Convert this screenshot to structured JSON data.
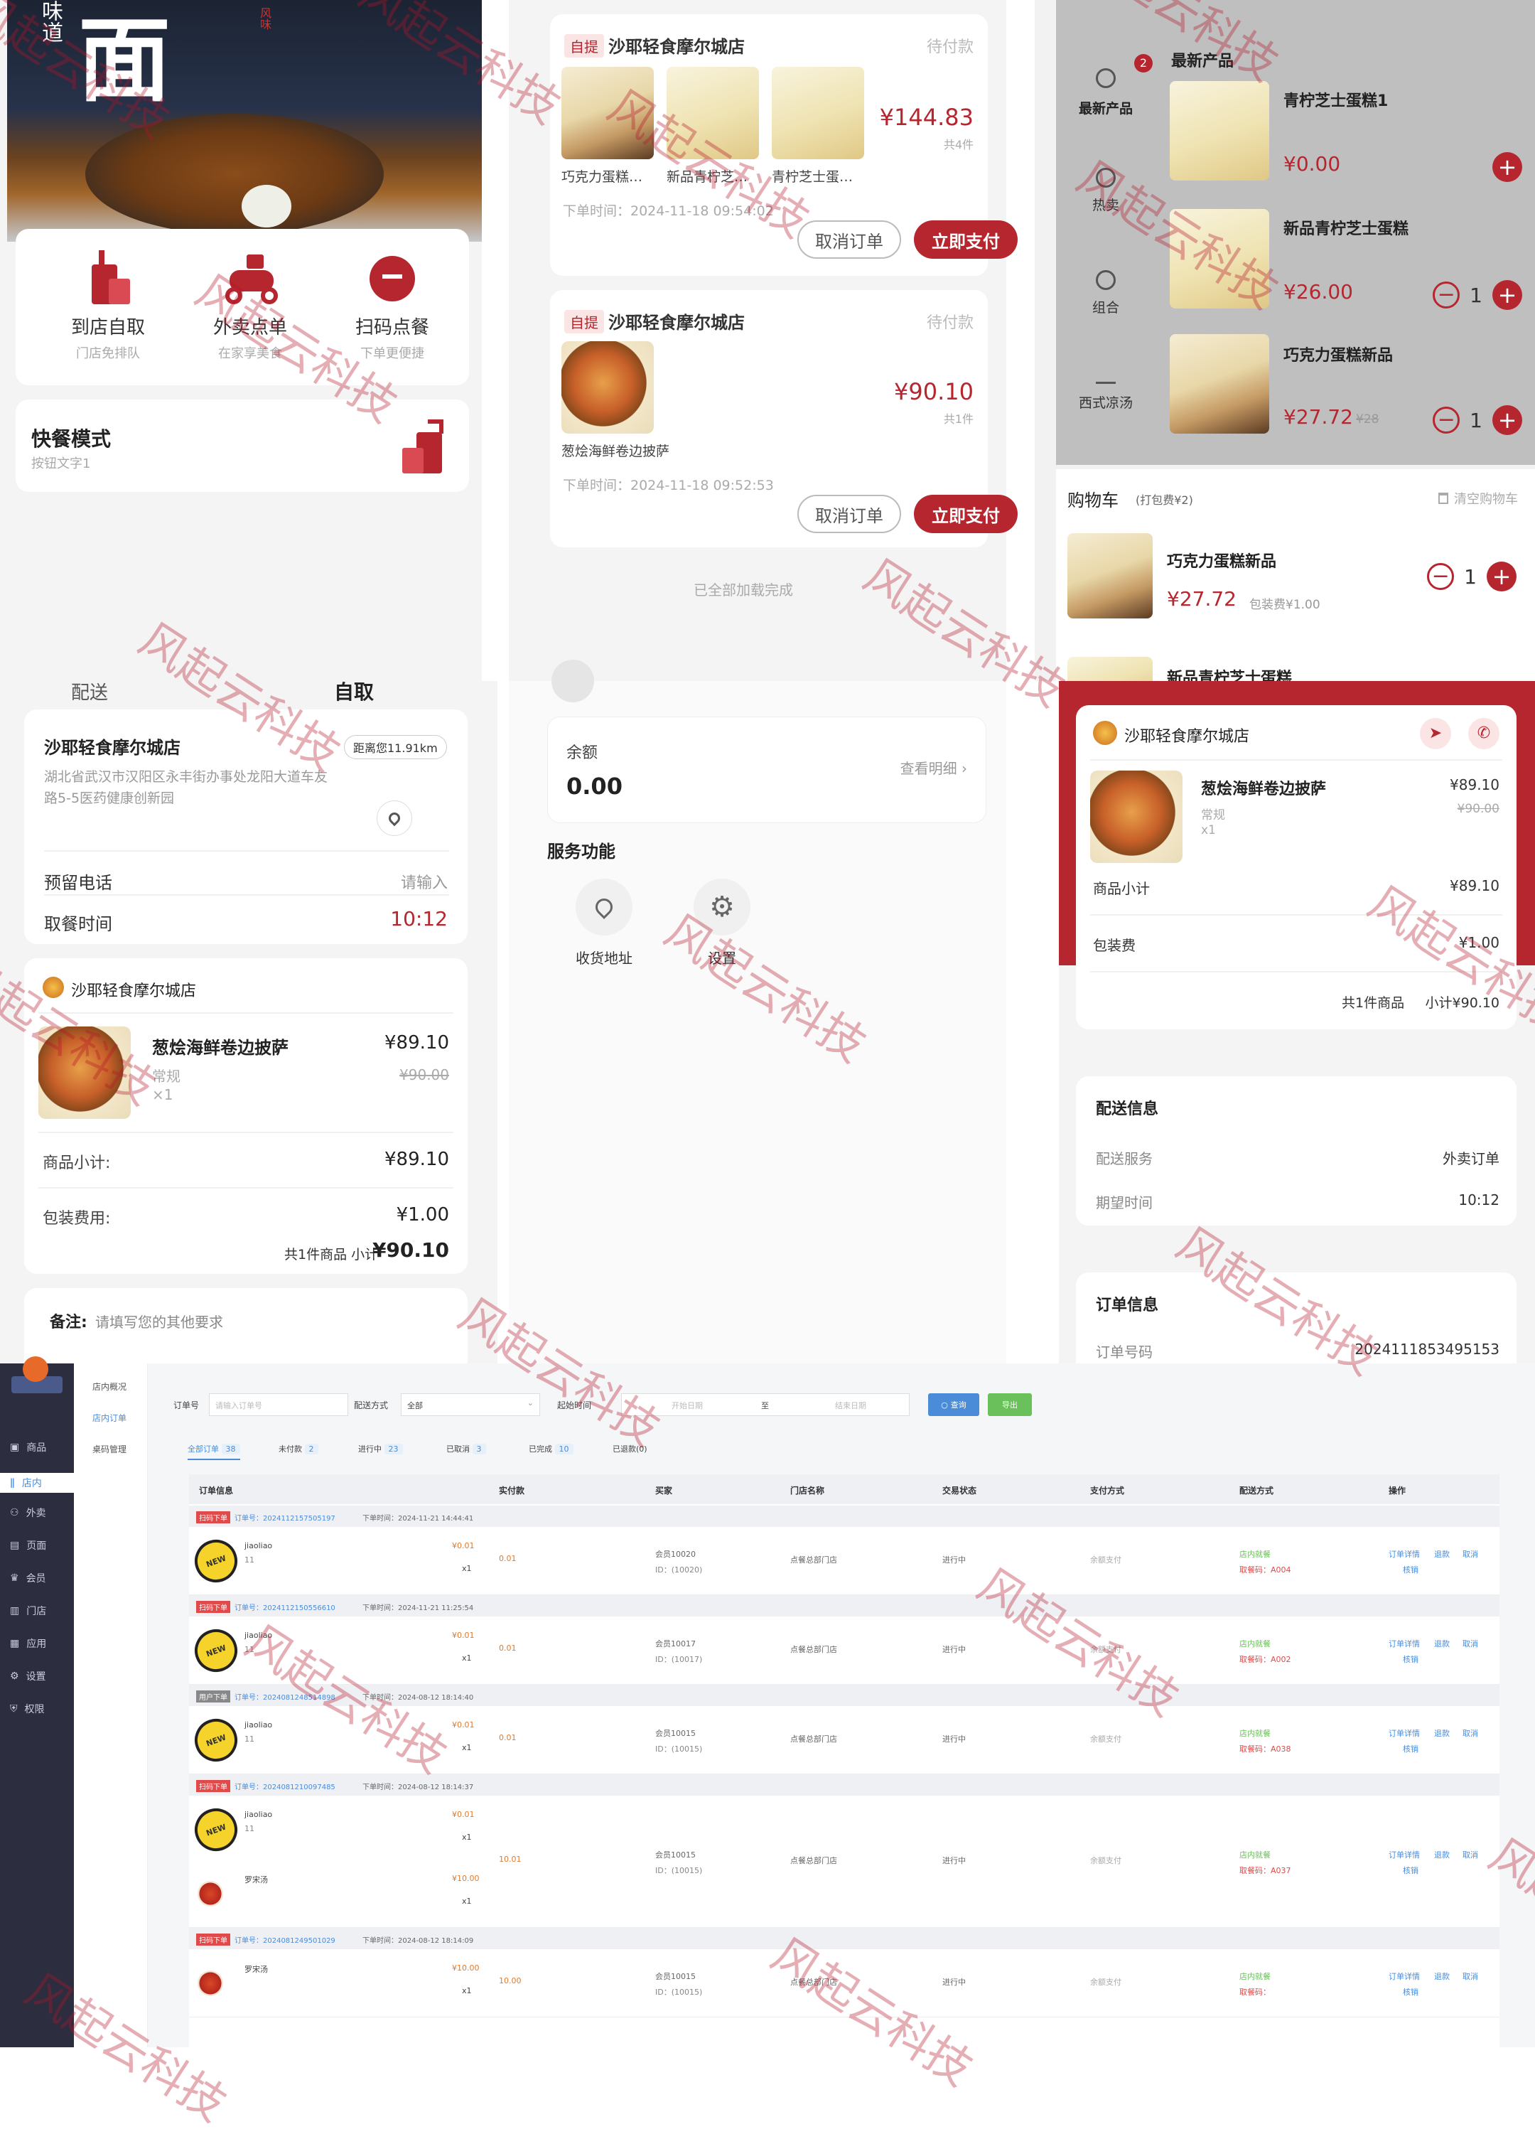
{
  "p1": {
    "banner_small": "味道",
    "banner_big": "面",
    "seal": "风味",
    "services": [
      {
        "title": "到店自取",
        "sub": "门店免排队",
        "icon": "cup-bag-icon"
      },
      {
        "title": "外卖点单",
        "sub": "在家享美食",
        "icon": "scooter-icon"
      },
      {
        "title": "扫码点餐",
        "sub": "下单更便捷",
        "icon": "scan-icon"
      }
    ],
    "quick_title": "快餐模式",
    "quick_sub": "按钮文字1"
  },
  "p2": {
    "orders": [
      {
        "tag": "自提",
        "store": "沙耶轻食摩尔城店",
        "status": "待付款",
        "price": "¥144.83",
        "count": "共4件",
        "items": [
          "巧克力蛋糕…",
          "新品青柠芝…",
          "青柠芝士蛋…"
        ],
        "time": "下单时间：2024-11-18 09:54:02",
        "cancel": "取消订单",
        "pay": "立即支付"
      },
      {
        "tag": "自提",
        "store": "沙耶轻食摩尔城店",
        "status": "待付款",
        "price": "¥90.10",
        "count": "共1件",
        "items": [
          "葱烩海鲜卷边披萨"
        ],
        "time": "下单时间：2024-11-18 09:52:53",
        "cancel": "取消订单",
        "pay": "立即支付"
      }
    ],
    "end_text": "已全部加载完成"
  },
  "p3": {
    "badge": "2",
    "cats": [
      "最新产品",
      "热卖",
      "组合",
      "西式凉汤"
    ],
    "section": "最新产品",
    "products": [
      {
        "name": "青柠芝士蛋糕1",
        "price": "¥0.00",
        "old": "",
        "qty": ""
      },
      {
        "name": "新品青柠芝士蛋糕",
        "price": "¥26.00",
        "old": "",
        "qty": "1"
      },
      {
        "name": "巧克力蛋糕新品",
        "price": "¥27.72",
        "old": "¥28",
        "qty": "1"
      }
    ],
    "cart_title": "购物车",
    "cart_pack": "(打包费¥2)",
    "cart_clear": "清空购物车",
    "cart_item": {
      "name": "巧克力蛋糕新品",
      "price": "¥27.72",
      "pack": "包装费¥1.00",
      "qty": "1"
    },
    "cart_next": "新品青柠芝士蛋糕"
  },
  "p4": {
    "tab_left": "配送",
    "tab_right": "自取",
    "store": "沙耶轻食摩尔城店",
    "distance": "距离您11.91km",
    "address": "湖北省武汉市汉阳区永丰街办事处龙阳大道车友路5-5医药健康创新园",
    "phone_label": "预留电话",
    "phone_ph": "请输入",
    "time_label": "取餐时间",
    "time_val": "10:12",
    "store2": "沙耶轻食摩尔城店",
    "item_name": "葱烩海鲜卷边披萨",
    "item_price": "¥89.10",
    "item_old": "¥90.00",
    "item_spec": "常规",
    "item_qty": "×1",
    "subtotal_label": "商品小计:",
    "subtotal": "¥89.10",
    "pack_label": "包装费用:",
    "pack": "¥1.00",
    "total_prefix": "共1件商品 小计",
    "total": "¥90.10",
    "remark_label": "备注:",
    "remark_ph": "请填写您的其他要求"
  },
  "p5": {
    "balance_label": "余额",
    "balance": "0.00",
    "detail": "查看明细",
    "service_title": "服务功能",
    "services": [
      {
        "label": "收货地址",
        "icon": "location-icon"
      },
      {
        "label": "设置",
        "icon": "gear-icon"
      }
    ]
  },
  "p6": {
    "store": "沙耶轻食摩尔城店",
    "item_name": "葱烩海鲜卷边披萨",
    "item_price": "¥89.10",
    "item_old": "¥90.00",
    "item_spec": "常规",
    "item_qty": "x1",
    "subtotal_label": "商品小计",
    "subtotal": "¥89.10",
    "pack_label": "包装费",
    "pack": "¥1.00",
    "total_count": "共1件商品",
    "total": "小计¥90.10",
    "delivery_title": "配送信息",
    "service_label": "配送服务",
    "service_val": "外卖订单",
    "expect_label": "期望时间",
    "expect_val": "10:12",
    "order_title": "订单信息",
    "order_no_label": "订单号码",
    "order_no": "2024111853495153"
  },
  "admin": {
    "sidebar": [
      "商品",
      "店内",
      "外卖",
      "页面",
      "会员",
      "门店",
      "应用",
      "设置",
      "权限"
    ],
    "subnav": [
      "店内概况",
      "店内订单",
      "桌码管理"
    ],
    "filters": {
      "order_label": "订单号",
      "order_ph": "请输入订单号",
      "delivery_label": "配送方式",
      "delivery_val": "全部",
      "time_label": "起始时间",
      "start_ph": "开始日期",
      "to": "至",
      "end_ph": "结束日期",
      "search": "查询",
      "export": "导出"
    },
    "tabs": [
      {
        "label": "全部订单",
        "count": "38"
      },
      {
        "label": "未付款",
        "count": "2"
      },
      {
        "label": "进行中",
        "count": "23"
      },
      {
        "label": "已取消",
        "count": "3"
      },
      {
        "label": "已完成",
        "count": "10"
      },
      {
        "label": "已退款(0)",
        "count": ""
      }
    ],
    "headers": [
      "订单信息",
      "实付款",
      "买家",
      "门店名称",
      "交易状态",
      "支付方式",
      "配送方式",
      "操作"
    ],
    "orders": [
      {
        "tag": "扫码下单",
        "no": "订单号：2024112157505197",
        "time": "下单时间：2024-11-21 14:44:41",
        "items": [
          {
            "name": "jiaoliao",
            "price": "¥0.01",
            "qty": "x1"
          }
        ],
        "paid": "0.01",
        "buyer": "会员10020",
        "buyer_id": "ID：(10020)",
        "store": "点餐总部门店",
        "status": "进行中",
        "pay": "余额支付",
        "delivery": "店内就餐",
        "code": "取餐码：A004"
      },
      {
        "tag": "扫码下单",
        "no": "订单号：2024112150556610",
        "time": "下单时间：2024-11-21 11:25:54",
        "items": [
          {
            "name": "jiaoliao",
            "price": "¥0.01",
            "qty": "x1"
          }
        ],
        "paid": "0.01",
        "buyer": "会员10017",
        "buyer_id": "ID：(10017)",
        "store": "点餐总部门店",
        "status": "进行中",
        "pay": "余额支付",
        "delivery": "店内就餐",
        "code": "取餐码：A002"
      },
      {
        "tag": "用户下单",
        "no": "订单号：2024081248514898",
        "time": "下单时间：2024-08-12 18:14:40",
        "items": [
          {
            "name": "jiaoliao",
            "price": "¥0.01",
            "qty": "x1"
          }
        ],
        "paid": "0.01",
        "buyer": "会员10015",
        "buyer_id": "ID：(10015)",
        "store": "点餐总部门店",
        "status": "进行中",
        "pay": "余额支付",
        "delivery": "店内就餐",
        "code": "取餐码：A038"
      },
      {
        "tag": "扫码下单",
        "no": "订单号：2024081210097485",
        "time": "下单时间：2024-08-12 18:14:37",
        "items": [
          {
            "name": "jiaoliao",
            "price": "¥0.01",
            "qty": "x1"
          },
          {
            "name": "罗宋汤",
            "price": "¥10.00",
            "qty": "x1"
          }
        ],
        "paid": "10.01",
        "buyer": "会员10015",
        "buyer_id": "ID：(10015)",
        "store": "点餐总部门店",
        "status": "进行中",
        "pay": "余额支付",
        "delivery": "店内就餐",
        "code": "取餐码：A037"
      },
      {
        "tag": "扫码下单",
        "no": "订单号：2024081249501029",
        "time": "下单时间：2024-08-12 18:14:09",
        "items": [
          {
            "name": "罗宋汤",
            "price": "¥10.00",
            "qty": "x1"
          }
        ],
        "paid": "10.00",
        "buyer": "会员10015",
        "buyer_id": "ID：(10015)",
        "store": "点餐总部门店",
        "status": "进行中",
        "pay": "余额支付",
        "delivery": "店内就餐",
        "code": "取餐码："
      }
    ],
    "ops": [
      "订单详情",
      "退款",
      "取消",
      "核销"
    ]
  },
  "watermark": "风起云科技"
}
